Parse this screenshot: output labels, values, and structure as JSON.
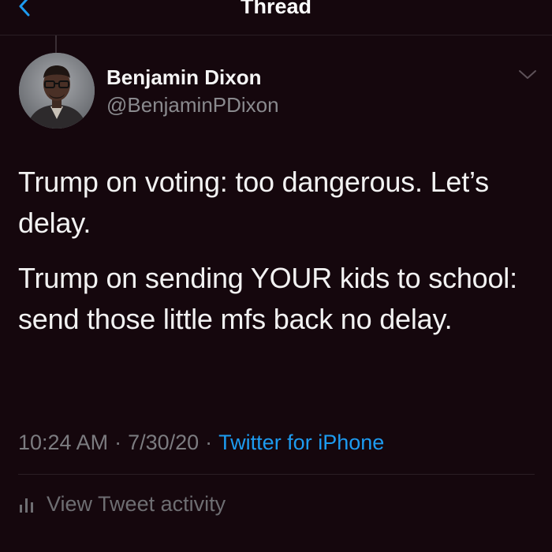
{
  "header": {
    "title": "Thread",
    "back_icon": "chevron-left-icon"
  },
  "tweet": {
    "author": {
      "display_name": "Benjamin Dixon",
      "handle": "@BenjaminPDixon"
    },
    "more_icon": "chevron-down-icon",
    "paragraphs": [
      "Trump on voting: too dangerous. Let’s delay.",
      "Trump on sending YOUR kids to school: send those little mfs back no delay."
    ],
    "time": "10:24 AM",
    "date": "7/30/20",
    "separator": "·",
    "source": "Twitter for iPhone",
    "activity_label": "View Tweet activity",
    "activity_icon": "bar-chart-icon"
  },
  "colors": {
    "background": "#15070d",
    "accent": "#1d9bf0",
    "muted": "#7c7c80"
  }
}
